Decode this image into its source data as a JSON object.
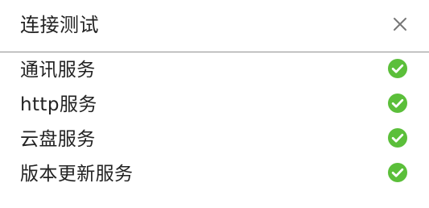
{
  "dialog": {
    "title": "连接测试",
    "close_icon": "close-icon"
  },
  "services": {
    "items": [
      {
        "label": "通讯服务",
        "status": "success",
        "icon": "check-circle-icon"
      },
      {
        "label": "http服务",
        "status": "success",
        "icon": "check-circle-icon"
      },
      {
        "label": "云盘服务",
        "status": "success",
        "icon": "check-circle-icon"
      },
      {
        "label": "版本更新服务",
        "status": "success",
        "icon": "check-circle-icon"
      }
    ]
  },
  "colors": {
    "success": "#5bbf3a",
    "divider": "#8f8f8f",
    "close": "#777777"
  }
}
